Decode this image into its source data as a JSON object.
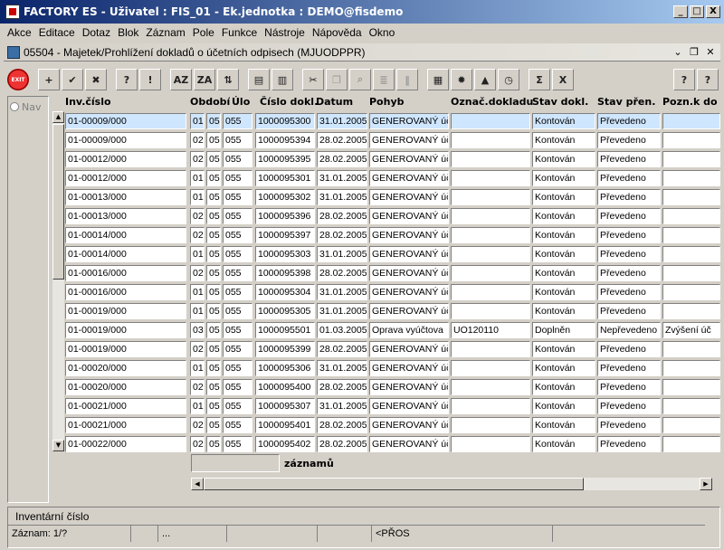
{
  "window": {
    "title": "FACTORY ES - Uživatel : FIS_01 - Ek.jednotka : DEMO@fisdemo",
    "buttons": [
      "_",
      "□",
      "X"
    ]
  },
  "menu": [
    "Akce",
    "Editace",
    "Dotaz",
    "Blok",
    "Záznam",
    "Pole",
    "Funkce",
    "Nástroje",
    "Nápověda",
    "Okno"
  ],
  "form": {
    "title": "05504 - Majetek/Prohlížení dokladů o účetních odpisech (MJUODPPR)"
  },
  "toolbar": {
    "exit_label": "EXIT",
    "buttons": [
      {
        "icon": "add-record-icon",
        "glyph": "+"
      },
      {
        "icon": "save-icon",
        "glyph": "✔"
      },
      {
        "icon": "delete-record-icon",
        "glyph": "✖"
      },
      {
        "icon": "query-icon",
        "glyph": "?"
      },
      {
        "icon": "execute-query-icon",
        "glyph": "!"
      },
      {
        "icon": "sort-asc-icon",
        "glyph": "AZ"
      },
      {
        "icon": "sort-desc-icon",
        "glyph": "ZA"
      },
      {
        "icon": "sort-multi-icon",
        "glyph": "⇅"
      },
      {
        "icon": "print-icon",
        "glyph": "▤"
      },
      {
        "icon": "report-icon",
        "glyph": "▥"
      },
      {
        "icon": "cut-icon",
        "glyph": "✂"
      },
      {
        "icon": "copy-icon",
        "glyph": "❐"
      },
      {
        "icon": "search-icon",
        "glyph": "⌕"
      },
      {
        "icon": "list-icon",
        "glyph": "≣"
      },
      {
        "icon": "columns-icon",
        "glyph": "‖"
      },
      {
        "icon": "calculator-icon",
        "glyph": "▦"
      },
      {
        "icon": "gear-icon",
        "glyph": "✹"
      },
      {
        "icon": "warning-icon",
        "glyph": "▲"
      },
      {
        "icon": "calendar-icon",
        "glyph": "◷"
      },
      {
        "icon": "sum-icon",
        "glyph": "Σ"
      },
      {
        "icon": "excel-icon",
        "glyph": "X"
      },
      {
        "icon": "help-icon",
        "glyph": "?"
      },
      {
        "icon": "context-help-icon",
        "glyph": "?"
      }
    ]
  },
  "nav": {
    "label": "Nav"
  },
  "grid": {
    "headers": [
      "Inv.číslo",
      "Období",
      "Úlo",
      "Číslo dokl.",
      "Datum",
      "Pohyb",
      "Označ.dokladu",
      "Stav dokl.",
      "Stav přen.",
      "Pozn.k do"
    ],
    "rows": [
      [
        "01-00009/000",
        "01",
        "05",
        "055",
        "1000095300",
        "31.01.2005 :",
        "GENEROVANÝ úč",
        "",
        "Kontován",
        "Převedeno",
        ""
      ],
      [
        "01-00009/000",
        "02",
        "05",
        "055",
        "1000095394",
        "28.02.2005 :",
        "GENEROVANÝ úč",
        "",
        "Kontován",
        "Převedeno",
        ""
      ],
      [
        "01-00012/000",
        "02",
        "05",
        "055",
        "1000095395",
        "28.02.2005 :",
        "GENEROVANÝ úč",
        "",
        "Kontován",
        "Převedeno",
        ""
      ],
      [
        "01-00012/000",
        "01",
        "05",
        "055",
        "1000095301",
        "31.01.2005 :",
        "GENEROVANÝ úč",
        "",
        "Kontován",
        "Převedeno",
        ""
      ],
      [
        "01-00013/000",
        "01",
        "05",
        "055",
        "1000095302",
        "31.01.2005 :",
        "GENEROVANÝ úč",
        "",
        "Kontován",
        "Převedeno",
        ""
      ],
      [
        "01-00013/000",
        "02",
        "05",
        "055",
        "1000095396",
        "28.02.2005 :",
        "GENEROVANÝ úč",
        "",
        "Kontován",
        "Převedeno",
        ""
      ],
      [
        "01-00014/000",
        "02",
        "05",
        "055",
        "1000095397",
        "28.02.2005 :",
        "GENEROVANÝ úč",
        "",
        "Kontován",
        "Převedeno",
        ""
      ],
      [
        "01-00014/000",
        "01",
        "05",
        "055",
        "1000095303",
        "31.01.2005 :",
        "GENEROVANÝ úč",
        "",
        "Kontován",
        "Převedeno",
        ""
      ],
      [
        "01-00016/000",
        "02",
        "05",
        "055",
        "1000095398",
        "28.02.2005 :",
        "GENEROVANÝ úč",
        "",
        "Kontován",
        "Převedeno",
        ""
      ],
      [
        "01-00016/000",
        "01",
        "05",
        "055",
        "1000095304",
        "31.01.2005 :",
        "GENEROVANÝ úč",
        "",
        "Kontován",
        "Převedeno",
        ""
      ],
      [
        "01-00019/000",
        "01",
        "05",
        "055",
        "1000095305",
        "31.01.2005 :",
        "GENEROVANÝ úč",
        "",
        "Kontován",
        "Převedeno",
        ""
      ],
      [
        "01-00019/000",
        "03",
        "05",
        "055",
        "1000095501",
        "01.03.2005 (",
        "Oprava vyúčtova",
        "UO120110",
        "Doplněn",
        "Nepřevedeno",
        "Zvýšení úč"
      ],
      [
        "01-00019/000",
        "02",
        "05",
        "055",
        "1000095399",
        "28.02.2005 :",
        "GENEROVANÝ úč",
        "",
        "Kontován",
        "Převedeno",
        ""
      ],
      [
        "01-00020/000",
        "01",
        "05",
        "055",
        "1000095306",
        "31.01.2005 :",
        "GENEROVANÝ úč",
        "",
        "Kontován",
        "Převedeno",
        ""
      ],
      [
        "01-00020/000",
        "02",
        "05",
        "055",
        "1000095400",
        "28.02.2005 :",
        "GENEROVANÝ úč",
        "",
        "Kontován",
        "Převedeno",
        ""
      ],
      [
        "01-00021/000",
        "01",
        "05",
        "055",
        "1000095307",
        "31.01.2005 :",
        "GENEROVANÝ úč",
        "",
        "Kontován",
        "Převedeno",
        ""
      ],
      [
        "01-00021/000",
        "02",
        "05",
        "055",
        "1000095401",
        "28.02.2005 :",
        "GENEROVANÝ úč",
        "",
        "Kontován",
        "Převedeno",
        ""
      ],
      [
        "01-00022/000",
        "02",
        "05",
        "055",
        "1000095402",
        "28.02.2005 :",
        "GENEROVANÝ úč",
        "",
        "Kontován",
        "Převedeno",
        ""
      ]
    ],
    "count_value": "",
    "count_label": "záznamů"
  },
  "status": {
    "hint": "Inventární číslo",
    "record": "Záznam: 1/?",
    "seg3": "...",
    "mode": "<PŘOS"
  },
  "colors": {
    "titlebar": "#0a246a",
    "selected_row": "#cfe6ff"
  }
}
